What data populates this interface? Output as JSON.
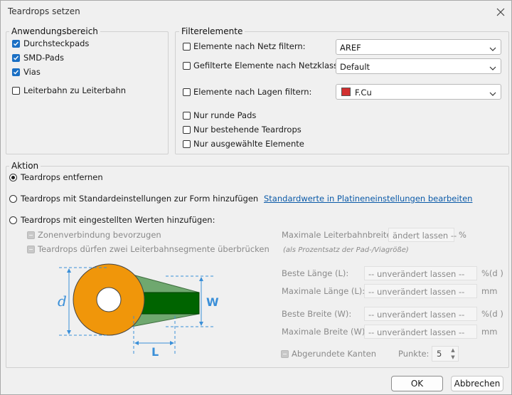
{
  "window": {
    "title": "Teardrops setzen"
  },
  "anwendungsbereich": {
    "legend": "Anwendungsbereich",
    "items": [
      {
        "label": "Durchsteckpads",
        "checked": true
      },
      {
        "label": "SMD-Pads",
        "checked": true
      },
      {
        "label": "Vias",
        "checked": true
      },
      {
        "label": "Leiterbahn zu Leiterbahn",
        "checked": false
      }
    ]
  },
  "filter": {
    "legend": "Filterelemente",
    "net_label": "Elemente nach Netz filtern:",
    "net_value": "AREF",
    "netclass_label": "Gefilterte Elemente nach Netzklasse:",
    "netclass_value": "Default",
    "layer_label": "Elemente nach Lagen filtern:",
    "layer_value": "F.Cu",
    "layer_color": "#d23030",
    "round_pads": "Nur runde Pads",
    "existing": "Nur bestehende Teardrops",
    "selected": "Nur ausgewählte Elemente"
  },
  "aktion": {
    "legend": "Aktion",
    "remove": "Teardrops entfernen",
    "add_default": "Teardrops mit Standardeinstellungen zur Form hinzufügen",
    "link": "Standardwerte in Platineneinstellungen bearbeiten",
    "add_custom": "Teardrops mit eingestellten Werten hinzufügen:",
    "zone_pref": "Zonenverbindung bevorzugen",
    "two_segments": "Teardrops dürfen zwei Leiterbahnsegmente überbrücken",
    "max_track_width_label": "Maximale Leiterbahnbreite:",
    "max_track_width_value": "ändert lassen --",
    "max_track_width_unit": "%",
    "pct_note": "(als Prozentsatz der Pad-/Viagröße)",
    "best_length_label": "Beste Länge (L):",
    "best_length_value": "-- unverändert lassen --",
    "best_length_unit": "%(d )",
    "max_length_label": "Maximale Länge (L):",
    "max_length_value": "-- unverändert lassen --",
    "max_length_unit": "mm",
    "best_width_label": "Beste Breite (W):",
    "best_width_value": "-- unverändert lassen --",
    "best_width_unit": "%(d )",
    "max_width_label": "Maximale Breite (W):",
    "max_width_value": "-- unverändert lassen --",
    "max_width_unit": "mm",
    "rounded_label": "Abgerundete Kanten",
    "points_label": "Punkte:",
    "points_value": "5",
    "diagram": {
      "d_label": "d",
      "w_label": "W",
      "l_label": "L"
    }
  },
  "buttons": {
    "ok": "OK",
    "cancel": "Abbrechen"
  },
  "colors": {
    "pad": "#f0960a",
    "teardrop": "#6fa86f",
    "track": "#006400",
    "dimension": "#3a8fd8"
  }
}
